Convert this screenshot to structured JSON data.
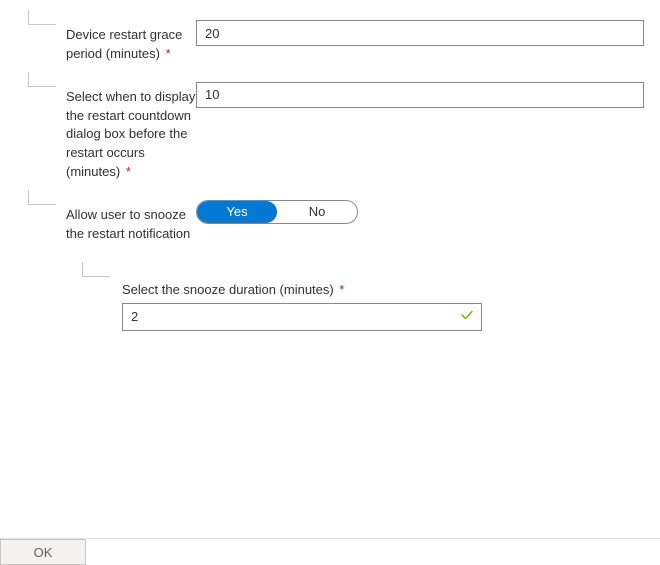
{
  "fields": {
    "restart_grace": {
      "label": "Device restart grace period (minutes)",
      "required_mark": "*",
      "value": "20"
    },
    "countdown_dialog": {
      "label": "Select when to display the restart countdown dialog box before the restart occurs (minutes)",
      "required_mark": "*",
      "value": "10"
    },
    "allow_snooze": {
      "label": "Allow user to snooze the restart notification",
      "option_yes": "Yes",
      "option_no": "No",
      "selected": "Yes"
    },
    "snooze_duration": {
      "label": "Select the snooze duration (minutes)",
      "required_mark": "*",
      "value": "2",
      "valid": true
    }
  },
  "footer": {
    "ok_label": "OK"
  }
}
